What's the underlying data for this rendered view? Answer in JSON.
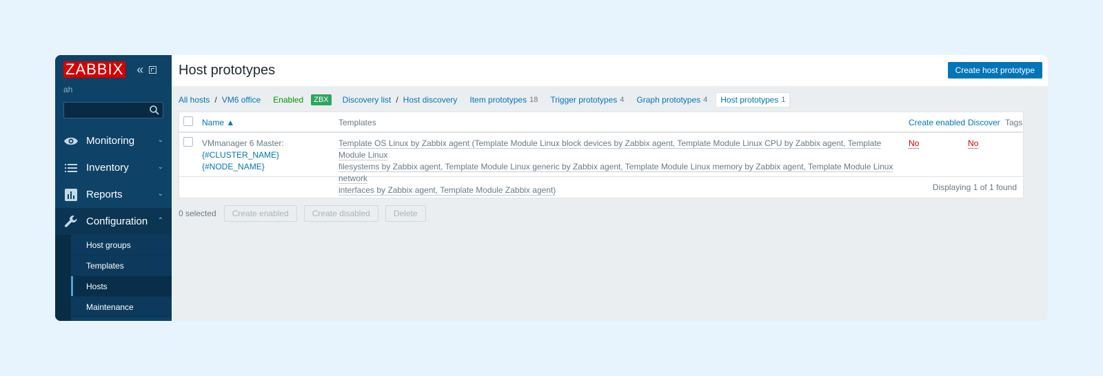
{
  "sidebar": {
    "logo": "ZABBIX",
    "user": "ah",
    "search": {
      "placeholder": ""
    },
    "menu": [
      {
        "label": "Monitoring",
        "icon": "eye-icon"
      },
      {
        "label": "Inventory",
        "icon": "list-icon"
      },
      {
        "label": "Reports",
        "icon": "chart-icon"
      },
      {
        "label": "Configuration",
        "icon": "wrench-icon"
      }
    ],
    "submenu": [
      {
        "label": "Host groups"
      },
      {
        "label": "Templates"
      },
      {
        "label": "Hosts"
      },
      {
        "label": "Maintenance"
      }
    ]
  },
  "header": {
    "title": "Host prototypes",
    "create_button": "Create host prototype"
  },
  "breadcrumbs": {
    "all_hosts": "All hosts",
    "sep": "/",
    "host": "VM6 office",
    "status": "Enabled",
    "badge": "ZBX",
    "discovery_list": "Discovery list",
    "discovery_rule": "Host discovery",
    "tabs": [
      {
        "label": "Item prototypes",
        "count": "18"
      },
      {
        "label": "Trigger prototypes",
        "count": "4"
      },
      {
        "label": "Graph prototypes",
        "count": "4"
      },
      {
        "label": "Host prototypes",
        "count": "1"
      }
    ]
  },
  "table": {
    "columns": {
      "name": "Name ▲",
      "templates": "Templates",
      "create_enabled": "Create enabled",
      "discover": "Discover",
      "tags": "Tags"
    },
    "rows": [
      {
        "name_prefix": "VMmanager 6 Master:",
        "name_macro1": "{#CLUSTER_NAME}",
        "name_macro2": "{#NODE_NAME}",
        "templates_line1": "Template OS Linux by Zabbix agent (Template Module Linux block devices by Zabbix agent, Template Module Linux CPU by Zabbix agent, Template Module Linux",
        "templates_line2": "filesystems by Zabbix agent, Template Module Linux generic by Zabbix agent, Template Module Linux memory by Zabbix agent, Template Module Linux network",
        "templates_line3": "interfaces by Zabbix agent, Template Module Zabbix agent)",
        "create_enabled": "No",
        "discover": "No"
      }
    ],
    "footer": "Displaying 1 of 1 found"
  },
  "actions": {
    "selected": "0 selected",
    "create_enabled": "Create enabled",
    "create_disabled": "Create disabled",
    "delete": "Delete"
  }
}
